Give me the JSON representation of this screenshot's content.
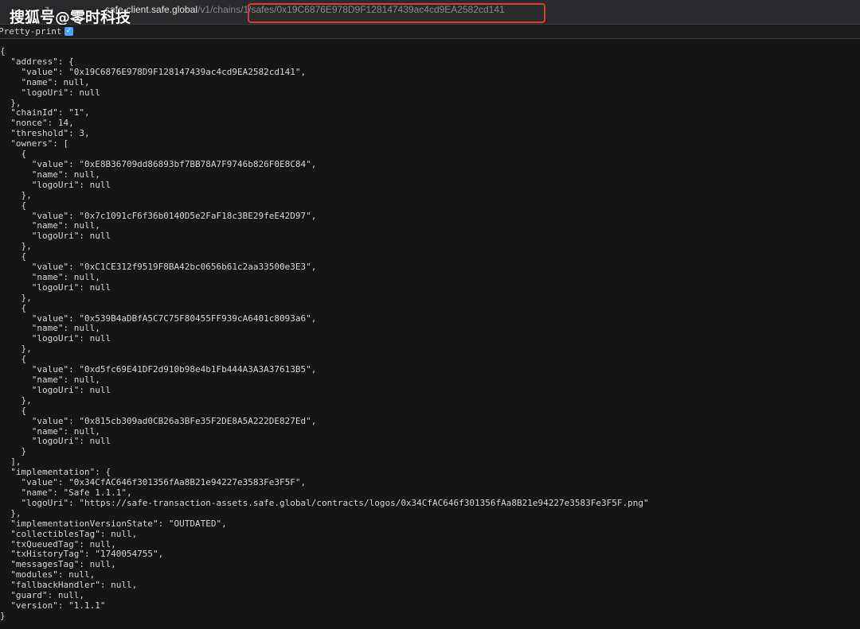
{
  "browser": {
    "url_host": "safe-client.safe.global",
    "url_path": "/v1/chains/1/safes/0x19C6876E978D9F128147439ac4cd9EA2582cd141",
    "back_icon": "chevron-left-icon",
    "forward_icon": "chevron-right-icon",
    "reload_icon": "reload-icon"
  },
  "watermark": {
    "text": "搜狐号@零时科技"
  },
  "toolbar": {
    "pretty_print_label": "Pretty-print",
    "pretty_print_checked": true
  },
  "colors": {
    "highlight_box": "#d93a2a",
    "background": "#161616",
    "checkbox": "#4aa3ff"
  },
  "json_lines": [
    "{",
    "  \"address\": {",
    "    \"value\": \"0x19C6876E978D9F128147439ac4cd9EA2582cd141\",",
    "    \"name\": null,",
    "    \"logoUri\": null",
    "  },",
    "  \"chainId\": \"1\",",
    "  \"nonce\": 14,",
    "  \"threshold\": 3,",
    "  \"owners\": [",
    "    {",
    "      \"value\": \"0xE8B36709dd86893bf7BB78A7F9746b826F0E8C84\",",
    "      \"name\": null,",
    "      \"logoUri\": null",
    "    },",
    "    {",
    "      \"value\": \"0x7c1091cF6f36b0140D5e2FaF18c3BE29feE42D97\",",
    "      \"name\": null,",
    "      \"logoUri\": null",
    "    },",
    "    {",
    "      \"value\": \"0xC1CE312f9519F8BA42bc0656b61c2aa33500e3E3\",",
    "      \"name\": null,",
    "      \"logoUri\": null",
    "    },",
    "    {",
    "      \"value\": \"0x539B4aDBfA5C7C75F80455FF939cA6401c8093a6\",",
    "      \"name\": null,",
    "      \"logoUri\": null",
    "    },",
    "    {",
    "      \"value\": \"0xd5fc69E41DF2d910b98e4b1Fb444A3A3A37613B5\",",
    "      \"name\": null,",
    "      \"logoUri\": null",
    "    },",
    "    {",
    "      \"value\": \"0x815cb309ad0CB26a3BFe35F2DE8A5A222DE827Ed\",",
    "      \"name\": null,",
    "      \"logoUri\": null",
    "    }",
    "  ],",
    "  \"implementation\": {",
    "    \"value\": \"0x34CfAC646f301356fAa8B21e94227e3583Fe3F5F\",",
    "    \"name\": \"Safe 1.1.1\",",
    "    \"logoUri\": \"https://safe-transaction-assets.safe.global/contracts/logos/0x34CfAC646f301356fAa8B21e94227e3583Fe3F5F.png\"",
    "  },",
    "  \"implementationVersionState\": \"OUTDATED\",",
    "  \"collectiblesTag\": null,",
    "  \"txQueuedTag\": null,",
    "  \"txHistoryTag\": \"1740054755\",",
    "  \"messagesTag\": null,",
    "  \"modules\": null,",
    "  \"fallbackHandler\": null,",
    "  \"guard\": null,",
    "  \"version\": \"1.1.1\"",
    "}"
  ]
}
